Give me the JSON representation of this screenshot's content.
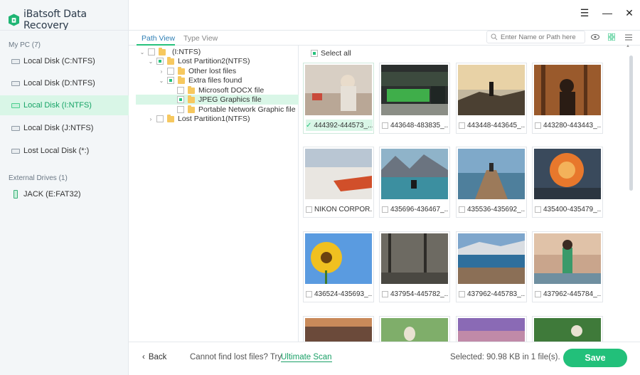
{
  "app": {
    "title": "iBatsoft Data Recovery"
  },
  "sidebar": {
    "my_pc_label": "My PC (7)",
    "disks": [
      {
        "label": "Local Disk (C:NTFS)"
      },
      {
        "label": "Local Disk (D:NTFS)"
      },
      {
        "label": "Local Disk (I:NTFS)"
      },
      {
        "label": "Local Disk (J:NTFS)"
      },
      {
        "label": "Lost Local Disk (*:)"
      }
    ],
    "external_label": "External Drives (1)",
    "external": [
      {
        "label": "JACK (E:FAT32)"
      }
    ]
  },
  "tabs": {
    "path_view": "Path View",
    "type_view": "Type View"
  },
  "search": {
    "placeholder": "Enter Name or Path here"
  },
  "tree": [
    {
      "label": "(I:NTFS)"
    },
    {
      "label": "Lost Partition2(NTFS)"
    },
    {
      "label": "Other lost files"
    },
    {
      "label": "Extra files found"
    },
    {
      "label": "Microsoft DOCX file"
    },
    {
      "label": "JPEG Graphics file"
    },
    {
      "label": "Portable Network Graphic file"
    },
    {
      "label": "Lost Partition1(NTFS)"
    }
  ],
  "grid": {
    "select_all": "Select all",
    "files": [
      {
        "name": "444392-444573_...",
        "checked": true
      },
      {
        "name": "443648-483835_..."
      },
      {
        "name": "443448-443645_..."
      },
      {
        "name": "443280-443443_..."
      },
      {
        "name": "NIKON CORPOR..."
      },
      {
        "name": "435696-436467_..."
      },
      {
        "name": "435536-435692_..."
      },
      {
        "name": "435400-435479_..."
      },
      {
        "name": "436524-435693_..."
      },
      {
        "name": "437954-445782_..."
      },
      {
        "name": "437962-445783_..."
      },
      {
        "name": "437962-445784_..."
      }
    ]
  },
  "footer": {
    "back_label": "Back",
    "lost_text": "Cannot find lost files? Try",
    "ultimate_scan": "Ultimate Scan",
    "selected_info": "Selected: 90.98 KB in 1 file(s).",
    "save_label": "Save"
  },
  "colors": {
    "accent": "#22c07a",
    "selected_bg": "#d9f6e7",
    "link": "#2f7fb5"
  }
}
